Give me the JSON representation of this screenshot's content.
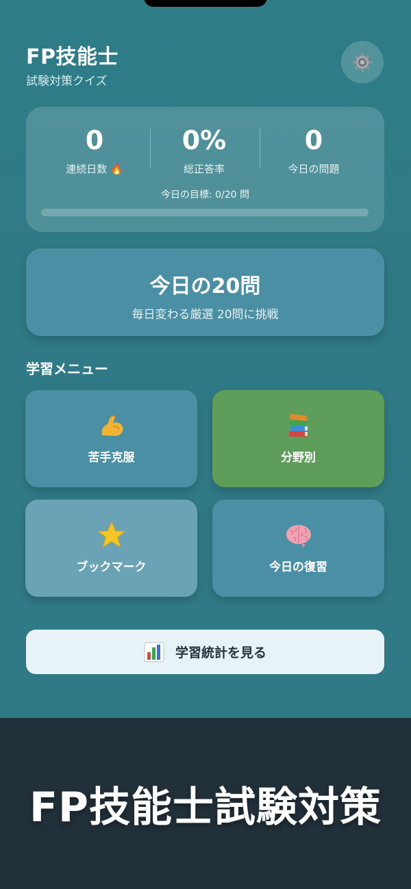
{
  "header": {
    "title": "FP技能士",
    "subtitle": "試験対策クイズ"
  },
  "stats": {
    "streak": {
      "value": "0",
      "label": "連続日数 🔥"
    },
    "accuracy": {
      "value": "0%",
      "label": "総正答率"
    },
    "today": {
      "value": "0",
      "label": "今日の問題"
    },
    "goal_text": "今日の目標: 0/20 問",
    "goal_progress": 0
  },
  "daily": {
    "title": "今日の20問",
    "subtitle": "毎日変わる厳選 20問に挑戦"
  },
  "menu": {
    "title": "学習メニュー",
    "items": [
      {
        "label": "苦手克服",
        "icon": "flexed-biceps-icon",
        "color": "#4a8fa3"
      },
      {
        "label": "分野別",
        "icon": "books-icon",
        "color": "#5e9d5a"
      },
      {
        "label": "ブックマーク",
        "icon": "star-icon",
        "color": "#6aa3b5"
      },
      {
        "label": "今日の復習",
        "icon": "brain-icon",
        "color": "#4a8fa3"
      }
    ]
  },
  "stats_button": {
    "label": "学習統計を見る",
    "icon": "bar-chart-icon"
  },
  "banner": {
    "text": "FP技能士試験対策"
  }
}
